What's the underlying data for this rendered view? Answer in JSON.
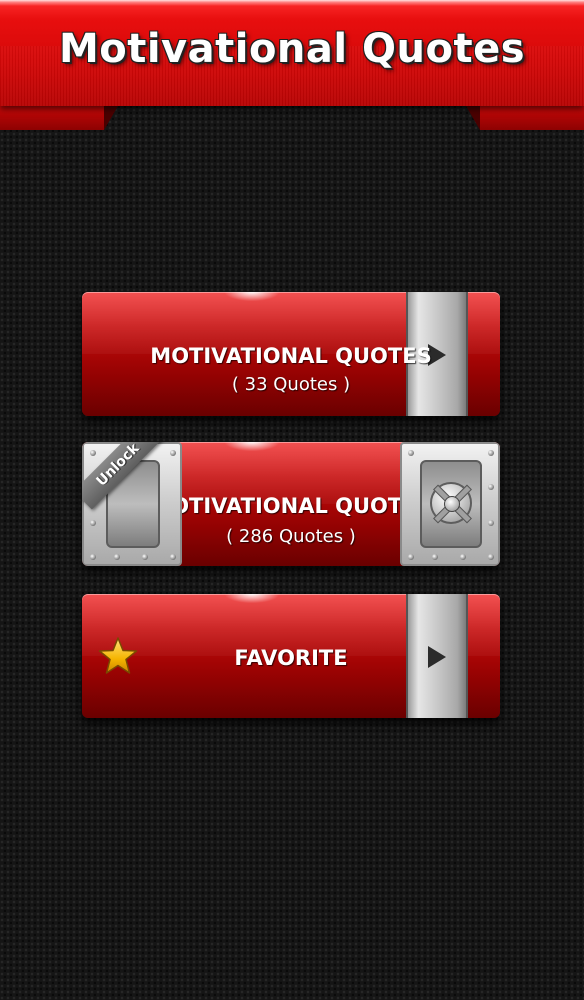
{
  "header": {
    "title": "Motivational Quotes"
  },
  "menu": {
    "items": [
      {
        "title": "MOTIVATIONAL QUOTES",
        "subtitle": "( 33 Quotes )",
        "locked": false,
        "icon": "play-arrow-icon"
      },
      {
        "title": "MOTIVATIONAL QUOTES",
        "subtitle": "( 286 Quotes )",
        "locked": true,
        "badge": "Unlock",
        "icon": "safe-lock-icon"
      },
      {
        "title": "FAVORITE",
        "locked": false,
        "icon": "play-arrow-icon",
        "leading_icon": "star-icon"
      }
    ]
  },
  "colors": {
    "banner_red": "#d40808",
    "button_red": "#b00606",
    "background": "#151515",
    "silver": "#c9c9c9",
    "star": "#f5b400"
  }
}
